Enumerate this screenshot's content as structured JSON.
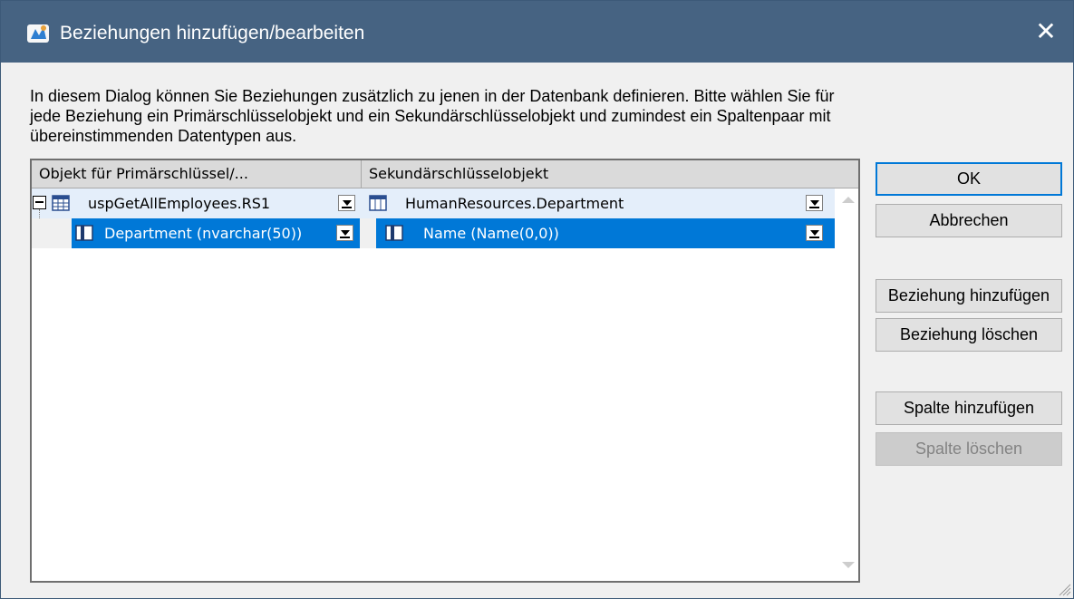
{
  "window": {
    "title": "Beziehungen hinzufügen/bearbeiten",
    "close_label": "✕",
    "titlebar_color": "#466382",
    "selection_color": "#0078d7"
  },
  "description": "In diesem Dialog können Sie Beziehungen zusätzlich zu jenen in der Datenbank definieren. Bitte wählen Sie für jede Beziehung ein Primärschlüsselobjekt und ein Sekundärschlüsselobjekt und zumindest ein Spaltenpaar mit übereinstimmenden Datentypen aus.",
  "grid": {
    "columns": [
      "Objekt für Primärschlüssel/...",
      "Sekundärschlüsselobjekt"
    ],
    "rows": [
      {
        "primary": "uspGetAllEmployees.RS1",
        "primary_icon": "table-icon",
        "secondary": "HumanResources.Department",
        "secondary_icon": "columns-icon",
        "expanded": true,
        "selected": false
      },
      {
        "primary": "Department (nvarchar(50))",
        "primary_icon": "column-icon",
        "secondary": "Name (Name(0,0))",
        "secondary_icon": "column-icon",
        "selected": true
      }
    ]
  },
  "buttons": {
    "ok": "OK",
    "cancel": "Abbrechen",
    "add_relation": "Beziehung hinzufügen",
    "delete_relation": "Beziehung löschen",
    "add_column": "Spalte hinzufügen",
    "delete_column": "Spalte löschen"
  }
}
